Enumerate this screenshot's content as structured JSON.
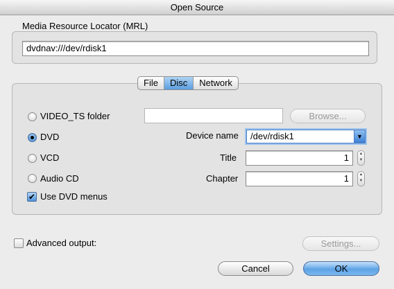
{
  "window": {
    "title": "Open Source"
  },
  "mrl": {
    "group_label": "Media Resource Locator (MRL)",
    "value": "dvdnav:///dev/rdisk1"
  },
  "tabs": [
    {
      "label": "File",
      "active": false
    },
    {
      "label": "Disc",
      "active": true
    },
    {
      "label": "Network",
      "active": false
    }
  ],
  "disc": {
    "options": [
      {
        "label": "VIDEO_TS folder",
        "selected": false
      },
      {
        "label": "DVD",
        "selected": true
      },
      {
        "label": "VCD",
        "selected": false
      },
      {
        "label": "Audio CD",
        "selected": false
      }
    ],
    "use_dvd_menus": {
      "label": "Use DVD menus",
      "checked": true
    },
    "folder_path": "",
    "browse_label": "Browse...",
    "device_name_label": "Device name",
    "device_name_value": "/dev/rdisk1",
    "title_label": "Title",
    "title_value": "1",
    "chapter_label": "Chapter",
    "chapter_value": "1"
  },
  "advanced": {
    "label": "Advanced output:",
    "checked": false
  },
  "settings_label": "Settings...",
  "cancel_label": "Cancel",
  "ok_label": "OK"
}
